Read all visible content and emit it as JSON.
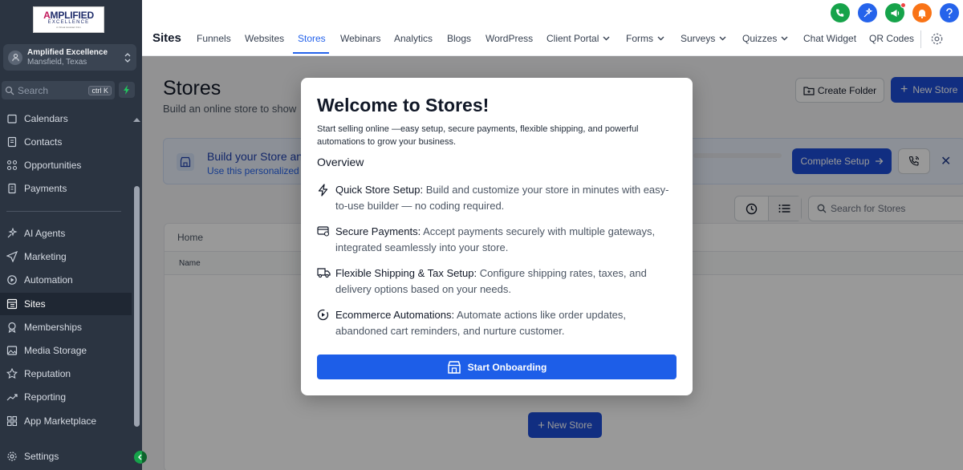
{
  "brand": {
    "logo_line1_a": "A",
    "logo_line1_rest": "MPLIFIED",
    "logo_line2": "EXCELLENCE",
    "logo_line3": "A Virtual Assistant Firm",
    "account_name": "Amplified Excellence",
    "account_location": "Mansfield, Texas"
  },
  "sidebar": {
    "search_placeholder": "Search",
    "search_shortcut": "ctrl K",
    "items": [
      {
        "label": "Calendars",
        "icon": "calendar-icon"
      },
      {
        "label": "Contacts",
        "icon": "contacts-icon"
      },
      {
        "label": "Opportunities",
        "icon": "opportunities-icon"
      },
      {
        "label": "Payments",
        "icon": "payments-icon"
      },
      {
        "label": "AI Agents",
        "icon": "sparkle-icon"
      },
      {
        "label": "Marketing",
        "icon": "send-icon"
      },
      {
        "label": "Automation",
        "icon": "automation-icon"
      },
      {
        "label": "Sites",
        "icon": "sites-icon",
        "active": true
      },
      {
        "label": "Memberships",
        "icon": "award-icon"
      },
      {
        "label": "Media Storage",
        "icon": "image-icon"
      },
      {
        "label": "Reputation",
        "icon": "star-icon"
      },
      {
        "label": "Reporting",
        "icon": "trend-icon"
      },
      {
        "label": "App Marketplace",
        "icon": "grid-icon"
      },
      {
        "label": "Settings",
        "icon": "gear-icon"
      }
    ]
  },
  "topbar": {
    "title": "Sites",
    "tabs": [
      {
        "label": "Funnels"
      },
      {
        "label": "Websites"
      },
      {
        "label": "Stores",
        "active": true
      },
      {
        "label": "Webinars"
      },
      {
        "label": "Analytics"
      },
      {
        "label": "Blogs"
      },
      {
        "label": "WordPress"
      },
      {
        "label": "Client Portal",
        "dropdown": true
      },
      {
        "label": "Forms",
        "dropdown": true
      },
      {
        "label": "Surveys",
        "dropdown": true
      },
      {
        "label": "Quizzes",
        "dropdown": true
      },
      {
        "label": "Chat Widget"
      },
      {
        "label": "QR Codes"
      }
    ],
    "header_actions": [
      {
        "name": "phone-icon",
        "color": "#16a34a"
      },
      {
        "name": "magic-icon",
        "color": "#2563eb"
      },
      {
        "name": "megaphone-icon",
        "color": "#16a34a"
      },
      {
        "name": "bell-icon",
        "color": "#f97316"
      },
      {
        "name": "help-icon",
        "color": "#2563eb"
      }
    ]
  },
  "page": {
    "heading": "Stores",
    "subheading": "Build an online store to show",
    "create_folder_label": "Create Folder",
    "new_store_label": "New Store",
    "banner_title": "Build your Store and",
    "banner_subtitle": "Use this personalized",
    "complete_setup_label": "Complete Setup",
    "store_search_placeholder": "Search for Stores",
    "breadcrumb": "Home",
    "column_name": "Name",
    "empty_new_store_label": "New Store"
  },
  "modal": {
    "title": "Welcome to Stores!",
    "intro": "Start selling online —easy setup, secure payments, flexible shipping, and powerful automations to grow your business.",
    "overview_label": "Overview",
    "features": [
      {
        "title": "Quick Store Setup:",
        "desc": " Build and customize your store in minutes with easy-to-use builder — no coding required.",
        "icon": "bolt-icon"
      },
      {
        "title": "Secure Payments:",
        "desc": " Accept payments securely with multiple gateways, integrated seamlessly into your store.",
        "icon": "card-icon"
      },
      {
        "title": "Flexible Shipping & Tax Setup:",
        "desc": " Configure shipping rates, taxes, and delivery options based on your needs.",
        "icon": "truck-icon"
      },
      {
        "title": "Ecommerce Automations:",
        "desc": " Automate actions like order updates, abandoned cart reminders, and nurture customer.",
        "icon": "automation-icon"
      }
    ],
    "cta_label": "Start Onboarding"
  },
  "colors": {
    "sidebar_bg": "#2b3441",
    "primary": "#1d4ed8",
    "accent_tab": "#2563eb"
  }
}
